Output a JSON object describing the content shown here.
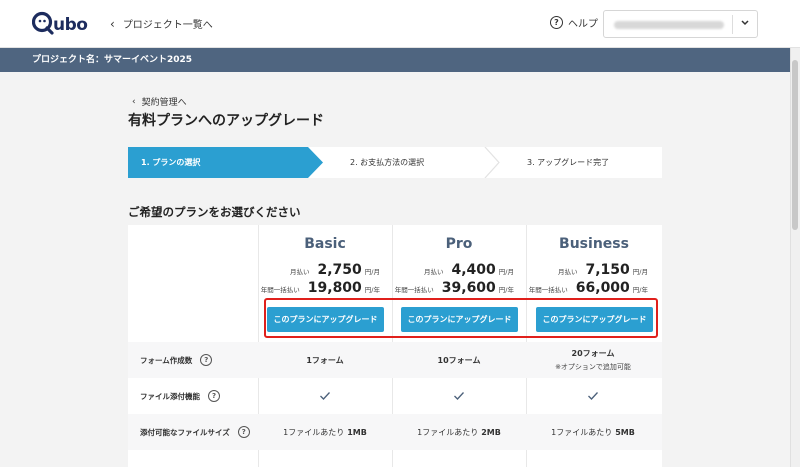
{
  "header": {
    "logo_text": "Qubo",
    "back_label": "プロジェクト一覧へ",
    "help_label": "ヘルプ"
  },
  "project_bar": {
    "label": "プロジェクト名：サマーイベント2025"
  },
  "breadcrumb": {
    "label": "契約管理へ"
  },
  "page_title": "有料プランへのアップグレード",
  "steps": [
    {
      "label": "1. プランの選択",
      "active": true
    },
    {
      "label": "2. お支払方法の選択",
      "active": false
    },
    {
      "label": "3. アップグレード完了",
      "active": false
    }
  ],
  "section_title": "ご希望のプランをお選びください",
  "price_labels": {
    "monthly": "月払い",
    "yearly": "年間一括払い",
    "monthly_unit": "円/月",
    "yearly_unit": "円/年"
  },
  "plans": [
    {
      "name": "Basic",
      "monthly": "2,750",
      "yearly": "19,800",
      "button": "このプランにアップグレード"
    },
    {
      "name": "Pro",
      "monthly": "4,400",
      "yearly": "39,600",
      "button": "このプランにアップグレード"
    },
    {
      "name": "Business",
      "monthly": "7,150",
      "yearly": "66,000",
      "button": "このプランにアップグレード"
    }
  ],
  "features": [
    {
      "label": "フォーム作成数",
      "values": [
        "1フォーム",
        "10フォーム",
        "20フォーム"
      ],
      "note": "※オプションで追加可能"
    },
    {
      "label": "ファイル添付機能",
      "values": [
        "check",
        "check",
        "check"
      ]
    },
    {
      "label": "添付可能なファイルサイズ",
      "prefix": "1ファイルあたり",
      "values": [
        "1MB",
        "2MB",
        "5MB"
      ]
    }
  ],
  "colors": {
    "accent": "#2b9fd1",
    "project_bar": "#4f6580",
    "highlight": "#e0201c"
  }
}
